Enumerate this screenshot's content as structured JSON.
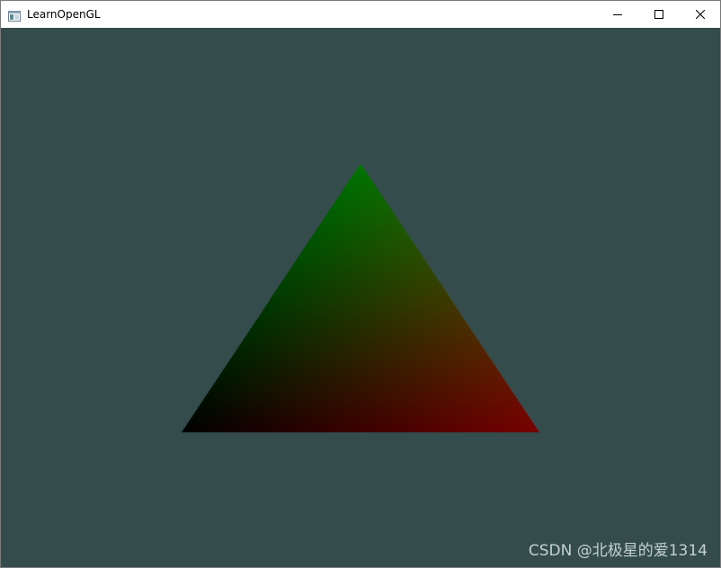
{
  "window": {
    "title": "LearnOpenGL",
    "app_icon": "window-app-icon",
    "controls": {
      "minimize_icon": "minimize-icon",
      "maximize_icon": "maximize-icon",
      "close_icon": "close-icon"
    }
  },
  "viewport": {
    "clear_color": "#344c4c",
    "triangle_vertex_colors": {
      "top": "#007400",
      "bottom_left": "#000000",
      "bottom_right": "#780000"
    }
  },
  "watermark": {
    "text": "CSDN @北极星的爱1314"
  }
}
